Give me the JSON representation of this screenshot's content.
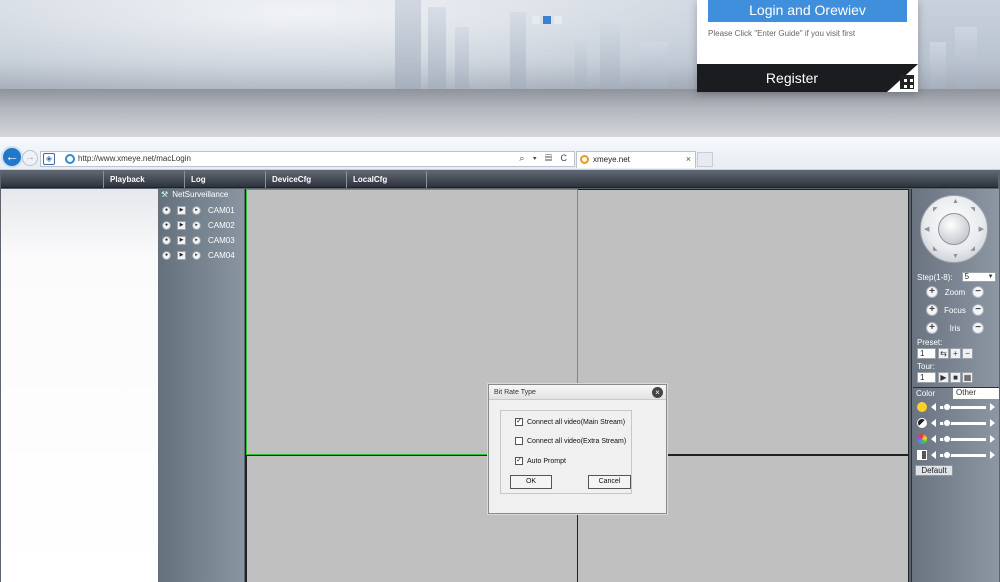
{
  "hero": {
    "login_button": "Login and Orewiev",
    "hint": "Please Click \"Enter Guide\" if you visit first",
    "register_button": "Register",
    "carousel_dots": 3,
    "carousel_active": 2
  },
  "browser": {
    "url": "http://www.xmeye.net/macLogin",
    "tab_title": "xmeye.net",
    "address_tools": "⌕ ▾ ▤ C"
  },
  "menu": {
    "items": [
      "Playback",
      "Log",
      "DeviceCfg",
      "LocalCfg"
    ]
  },
  "device_tree": {
    "root": "NetSurveillance",
    "cameras": [
      "CAM01",
      "CAM02",
      "CAM03",
      "CAM04"
    ]
  },
  "ptz": {
    "step_label": "Step(1-8):",
    "step_value": "5",
    "zoom_label": "Zoom",
    "focus_label": "Focus",
    "iris_label": "Iris",
    "preset_label": "Preset:",
    "preset_value": "1",
    "tour_label": "Tour:",
    "tour_value": "1",
    "color_tab": "Color",
    "other_tab": "Other",
    "default_button": "Default",
    "slider_levels": [
      0.08,
      0.08,
      0.08,
      0.08
    ]
  },
  "dialog": {
    "title": "Bit Rate Type",
    "option_main": "Connect all video(Main Stream)",
    "option_main_checked": true,
    "option_extra": "Connect all video(Extra Stream)",
    "option_extra_checked": false,
    "option_auto": "Auto Prompt",
    "option_auto_checked": true,
    "ok": "OK",
    "cancel": "Cancel"
  },
  "colors": {
    "accent": "#3f8fdc",
    "selected_pane": "#2ec02e"
  }
}
